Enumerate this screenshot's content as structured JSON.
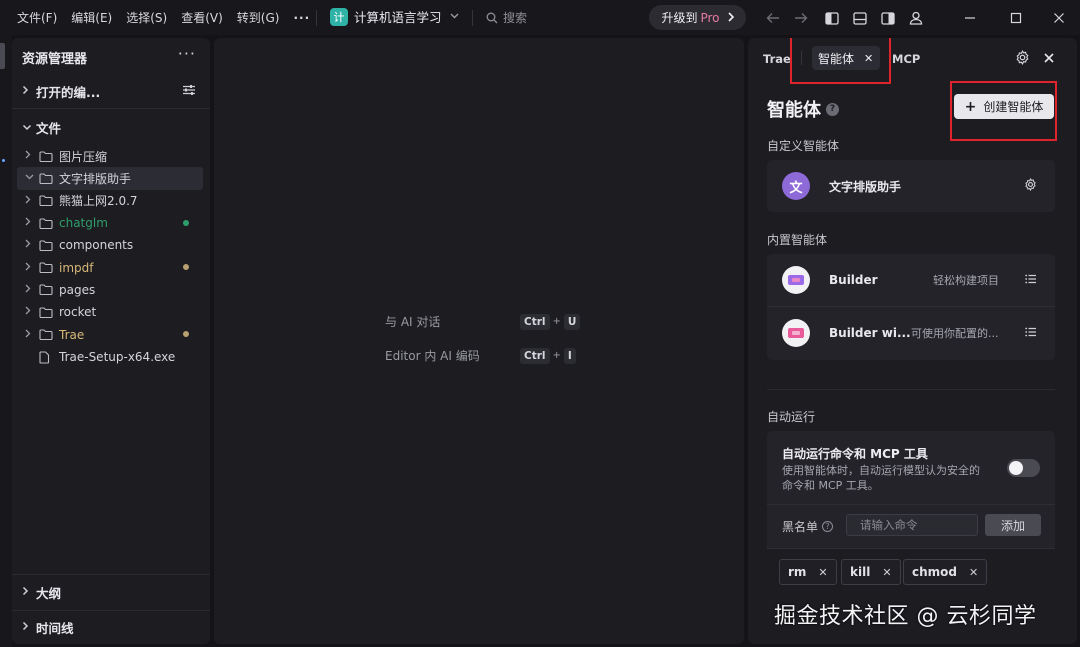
{
  "menu": [
    "文件(F)",
    "编辑(E)",
    "选择(S)",
    "查看(V)",
    "转到(G)",
    "···"
  ],
  "project": {
    "badge": "计",
    "name": "计算机语言学习"
  },
  "search": {
    "placeholder": "搜索"
  },
  "upgrade": {
    "label": "升级到",
    "pro": "Pro"
  },
  "explorer": {
    "title": "资源管理器",
    "open_editors": "打开的编...",
    "files_section": "文件",
    "items": [
      {
        "name": "图片压缩",
        "type": "folder",
        "color": "#d4d4da"
      },
      {
        "name": "文字排版助手",
        "type": "folder",
        "color": "#d4d4da",
        "selected": true,
        "expanded": true
      },
      {
        "name": "熊猫上网2.0.7",
        "type": "folder",
        "color": "#d4d4da"
      },
      {
        "name": "chatglm",
        "type": "folder",
        "color": "#2f9e6a",
        "dot": "#2f9e6a"
      },
      {
        "name": "components",
        "type": "folder",
        "color": "#d4d4da"
      },
      {
        "name": "impdf",
        "type": "folder",
        "color": "#d8b878",
        "dot": "#b8a070"
      },
      {
        "name": "pages",
        "type": "folder",
        "color": "#d4d4da"
      },
      {
        "name": "rocket",
        "type": "folder",
        "color": "#d4d4da"
      },
      {
        "name": "Trae",
        "type": "folder",
        "color": "#d8b878",
        "dot": "#b8a070"
      },
      {
        "name": "Trae-Setup-x64.exe",
        "type": "file",
        "color": "#d4d4da"
      }
    ],
    "outline": "大纲",
    "timeline": "时间线"
  },
  "editor": {
    "hints": [
      {
        "label": "与 AI 对话",
        "keys": [
          "Ctrl",
          "U"
        ]
      },
      {
        "label": "Editor 内 AI 编码",
        "keys": [
          "Ctrl",
          "I"
        ]
      }
    ]
  },
  "panel": {
    "tabs": {
      "trae": "Trae",
      "agents": "智能体",
      "mcp": "MCP"
    },
    "title": "智能体",
    "create_button": "创建智能体",
    "custom_section": "自定义智能体",
    "custom_agents": [
      {
        "name": "文字排版助手",
        "avatar": "文"
      }
    ],
    "builtin_section": "内置智能体",
    "builtin_agents": [
      {
        "name": "Builder",
        "desc": "轻松构建项目"
      },
      {
        "name": "Builder wi...",
        "desc": "可使用你配置的..."
      }
    ],
    "auto_section": "自动运行",
    "auto_title": "自动运行命令和 MCP 工具",
    "auto_desc": "使用智能体时，自动运行模型认为安全的命令和 MCP 工具。",
    "blacklist_label": "黑名单",
    "blacklist_placeholder": "请输入命令",
    "blacklist_add": "添加",
    "blacklist_items": [
      "rm",
      "kill",
      "chmod"
    ]
  },
  "watermark": "掘金技术社区 @ 云杉同学",
  "colors": {
    "accent_red": "#e0242b",
    "badge_teal": "#2fb3a7",
    "pro_pink": "#e87aa2"
  }
}
